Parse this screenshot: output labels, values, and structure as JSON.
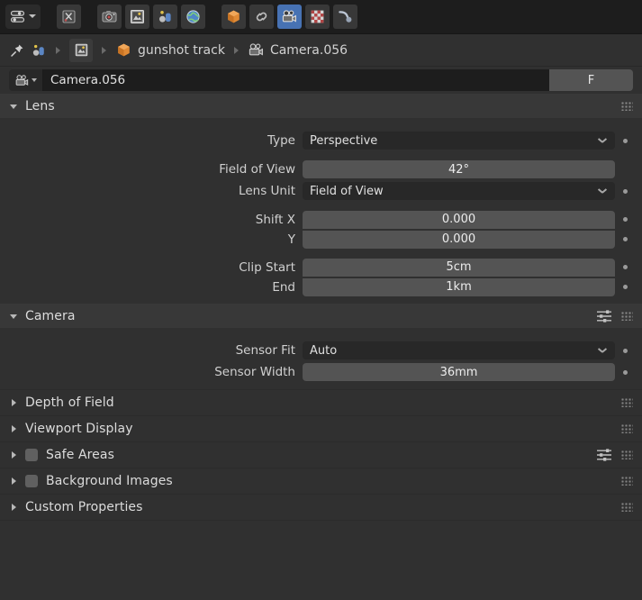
{
  "topbar": {
    "editor_selector": {
      "name": "editor-type-selector",
      "icon": "properties-editor-icon"
    },
    "tabs": [
      {
        "name": "tool",
        "icon": "tool-icon",
        "active": false
      },
      {
        "name": "render",
        "icon": "render-icon",
        "active": false
      },
      {
        "name": "output",
        "icon": "output-icon",
        "active": false
      },
      {
        "name": "view-layer",
        "icon": "view-layer-icon",
        "active": false
      },
      {
        "name": "scene",
        "icon": "scene-icon",
        "active": false
      },
      {
        "name": "world",
        "icon": "world-icon",
        "active": false
      },
      {
        "name": "object",
        "icon": "object-icon",
        "active": false
      },
      {
        "name": "constraints",
        "icon": "constraints-icon",
        "active": false
      },
      {
        "name": "object-data",
        "icon": "camera-data-icon",
        "active": true
      },
      {
        "name": "texture",
        "icon": "texture-icon",
        "active": false
      },
      {
        "name": "physics",
        "icon": "physics-icon",
        "active": false
      }
    ]
  },
  "breadcrumb": {
    "pin_icon": "pin-icon",
    "scene_icon": "scene-icon",
    "view_layer_icon": "view-layer-icon",
    "object_label": "gunshot track",
    "object_icon": "object-icon",
    "data_label": "Camera.056",
    "data_icon": "camera-data-icon"
  },
  "id_row": {
    "icon": "camera-data-icon",
    "name_value": "Camera.056",
    "fake_user_label": "F"
  },
  "panels": {
    "lens": {
      "title": "Lens",
      "expanded": true,
      "rows": [
        {
          "label": "Type",
          "value": "Perspective",
          "widget": "dropdown",
          "decorator": true
        },
        {
          "label": "Field of View",
          "value": "42°",
          "widget": "slider",
          "decorator": false
        },
        {
          "label": "Lens Unit",
          "value": "Field of View",
          "widget": "dropdown",
          "decorator": true
        },
        {
          "label": "Shift X",
          "value": "0.000",
          "widget": "slider",
          "decorator": true
        },
        {
          "label": "Y",
          "value": "0.000",
          "widget": "slider",
          "decorator": true
        },
        {
          "label": "Clip Start",
          "value": "5cm",
          "widget": "slider",
          "decorator": true
        },
        {
          "label": "End",
          "value": "1km",
          "widget": "slider",
          "decorator": true
        }
      ]
    },
    "camera": {
      "title": "Camera",
      "expanded": true,
      "has_presets": true,
      "rows": [
        {
          "label": "Sensor Fit",
          "value": "Auto",
          "widget": "dropdown",
          "decorator": true
        },
        {
          "label": "Sensor Width",
          "value": "36mm",
          "widget": "slider",
          "decorator": true
        }
      ]
    },
    "collapsed": [
      {
        "title": "Depth of Field",
        "checkbox": false,
        "presets": false
      },
      {
        "title": "Viewport Display",
        "checkbox": false,
        "presets": false
      },
      {
        "title": "Safe Areas",
        "checkbox": true,
        "presets": true
      },
      {
        "title": "Background Images",
        "checkbox": true,
        "presets": false
      },
      {
        "title": "Custom Properties",
        "checkbox": false,
        "presets": false
      }
    ]
  },
  "colors": {
    "window_bg": "#303030",
    "topbar_bg": "#1d1d1d",
    "panel_header_bg": "#383838",
    "field_dark": "#282828",
    "field_slider": "#545454",
    "accent_active_tab": "#4772b3",
    "text": "#d0d0d0",
    "object_orange": "#e08a35"
  }
}
